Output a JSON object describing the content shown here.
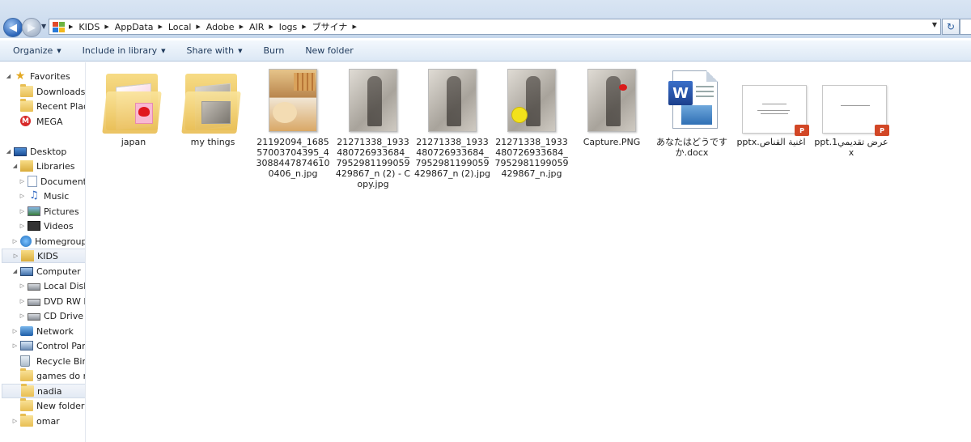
{
  "window": {
    "breadcrumb": [
      "KIDS",
      "AppData",
      "Local",
      "Adobe",
      "AIR",
      "logs",
      "ブサイナ"
    ]
  },
  "toolbar": {
    "organize": "Organize",
    "include_in_library": "Include in library",
    "share_with": "Share with",
    "burn": "Burn",
    "new_folder": "New folder"
  },
  "nav": [
    {
      "label": "Favorites",
      "icon": "star-icon"
    },
    {
      "label": "Downloads",
      "icon": "downloads-folder-icon"
    },
    {
      "label": "Recent Places",
      "icon": "recent-places-icon"
    },
    {
      "label": "MEGA",
      "icon": "mega-icon"
    },
    {
      "label": "Desktop",
      "icon": "desktop-icon"
    },
    {
      "label": "Libraries",
      "icon": "libraries-icon"
    },
    {
      "label": "Documents",
      "icon": "documents-icon"
    },
    {
      "label": "Music",
      "icon": "music-icon"
    },
    {
      "label": "Pictures",
      "icon": "pictures-icon"
    },
    {
      "label": "Videos",
      "icon": "videos-icon"
    },
    {
      "label": "Homegroup",
      "icon": "homegroup-icon"
    },
    {
      "label": "KIDS",
      "icon": "user-folder-icon"
    },
    {
      "label": "Computer",
      "icon": "computer-icon"
    },
    {
      "label": "Local Disk (",
      "icon": "local-disk-icon"
    },
    {
      "label": "DVD RW Dr",
      "icon": "dvd-drive-icon"
    },
    {
      "label": "CD Drive (F",
      "icon": "cd-drive-icon"
    },
    {
      "label": "Network",
      "icon": "network-icon"
    },
    {
      "label": "Control Pane",
      "icon": "control-panel-icon"
    },
    {
      "label": "Recycle Bin",
      "icon": "recycle-bin-icon"
    },
    {
      "label": "games do no",
      "icon": "folder-icon"
    },
    {
      "label": "nadia",
      "icon": "folder-icon"
    },
    {
      "label": "New folder",
      "icon": "folder-icon"
    },
    {
      "label": "omar",
      "icon": "folder-icon"
    }
  ],
  "files": [
    {
      "name": "japan",
      "type": "folder"
    },
    {
      "name": "my things",
      "type": "folder"
    },
    {
      "name": "21192094_168557003704395_430884478746100406_n.jpg",
      "type": "jpg"
    },
    {
      "name": "21271338_1933480726933684_7952981199059429867_n (2) - Copy.jpg",
      "type": "jpg"
    },
    {
      "name": "21271338_1933480726933684_7952981199059429867_n (2).jpg",
      "type": "jpg"
    },
    {
      "name": "21271338_1933480726933684_7952981199059429867_n.jpg",
      "type": "jpg"
    },
    {
      "name": "Capture.PNG",
      "type": "png"
    },
    {
      "name": "あなたはどうですか.docx",
      "type": "docx"
    },
    {
      "name": "اغنية القناص.pptx",
      "type": "pptx"
    },
    {
      "name": "عرض تقديمي1.pptx",
      "type": "pptx"
    }
  ]
}
